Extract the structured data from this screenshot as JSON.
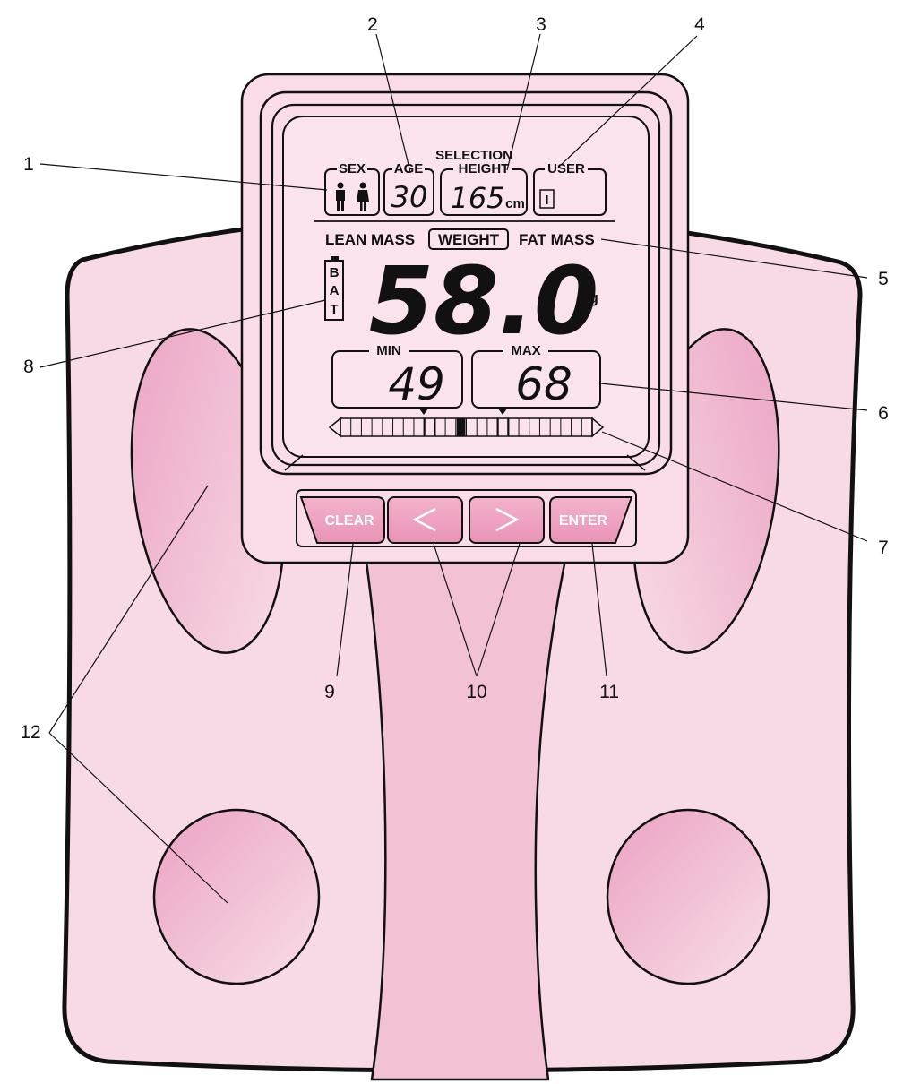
{
  "colors": {
    "body_pink": "#f8d9e6",
    "panel_pink": "#f9dce8",
    "center_strip": "#f2bfd3",
    "electrode_pink": "#eeabc8",
    "button_pink": "#ee9dbd",
    "outline": "#111111"
  },
  "callouts": {
    "c1": "1",
    "c2": "2",
    "c3": "3",
    "c4": "4",
    "c5": "5",
    "c6": "6",
    "c7": "7",
    "c8": "8",
    "c9": "9",
    "c10": "10",
    "c11": "11",
    "c12": "12"
  },
  "display": {
    "selection_label": "SELECTION",
    "sex_label": "SEX",
    "age_label": "AGE",
    "age_value": "30",
    "height_label": "HEIGHT",
    "height_value": "165",
    "height_unit": "cm",
    "user_label": "USER",
    "user_value": "I",
    "lean_mass_label": "LEAN MASS",
    "weight_label": "WEIGHT",
    "fat_mass_label": "FAT MASS",
    "battery_letters": [
      "B",
      "A",
      "T"
    ],
    "main_value": "58.0",
    "main_unit": "kg",
    "min_label": "MIN",
    "min_value": "49",
    "max_label": "MAX",
    "max_value": "68"
  },
  "buttons": {
    "clear": "CLEAR",
    "left": "<",
    "right": ">",
    "enter": "ENTER"
  },
  "icons": {
    "sex_icons": [
      "male-figure-icon",
      "female-figure-icon"
    ],
    "battery": "battery-icon",
    "range_bar": "range-bar-icon"
  }
}
